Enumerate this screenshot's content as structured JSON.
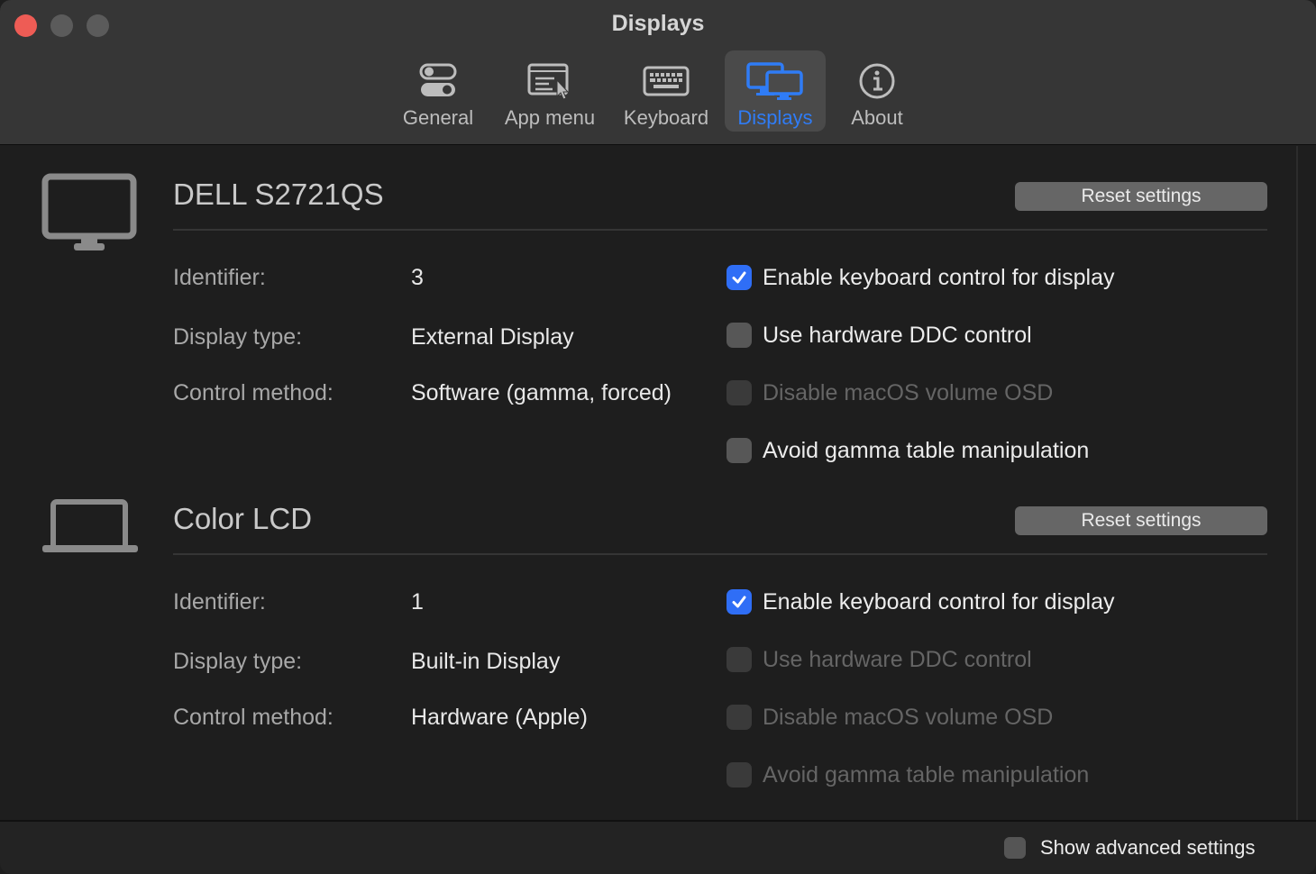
{
  "window": {
    "title": "Displays"
  },
  "tabs": [
    {
      "label": "General",
      "icon": "toggles-icon"
    },
    {
      "label": "App menu",
      "icon": "app-menu-icon"
    },
    {
      "label": "Keyboard",
      "icon": "keyboard-icon"
    },
    {
      "label": "Displays",
      "icon": "displays-icon",
      "active": true
    },
    {
      "label": "About",
      "icon": "info-icon"
    }
  ],
  "displays": [
    {
      "icon": "monitor-icon",
      "name": "DELL S2721QS",
      "reset_label": "Reset settings",
      "info": [
        {
          "label": "Identifier:",
          "value": "3"
        },
        {
          "label": "Display type:",
          "value": "External Display"
        },
        {
          "label": "Control method:",
          "value": "Software (gamma, forced)"
        }
      ],
      "options": [
        {
          "label": "Enable keyboard control for display",
          "checked": true,
          "enabled": true
        },
        {
          "label": "Use hardware DDC control",
          "checked": false,
          "enabled": true
        },
        {
          "label": "Disable macOS volume OSD",
          "checked": false,
          "enabled": false
        },
        {
          "label": "Avoid gamma table manipulation",
          "checked": false,
          "enabled": true
        }
      ]
    },
    {
      "icon": "laptop-icon",
      "name": "Color LCD",
      "reset_label": "Reset settings",
      "info": [
        {
          "label": "Identifier:",
          "value": "1"
        },
        {
          "label": "Display type:",
          "value": "Built-in Display"
        },
        {
          "label": "Control method:",
          "value": "Hardware (Apple)"
        }
      ],
      "options": [
        {
          "label": "Enable keyboard control for display",
          "checked": true,
          "enabled": true
        },
        {
          "label": "Use hardware DDC control",
          "checked": false,
          "enabled": false
        },
        {
          "label": "Disable macOS volume OSD",
          "checked": false,
          "enabled": false
        },
        {
          "label": "Avoid gamma table manipulation",
          "checked": false,
          "enabled": false
        }
      ]
    }
  ],
  "footer": {
    "show_advanced_label": "Show advanced settings",
    "show_advanced_checked": false
  },
  "colors": {
    "accent": "#2f7cf6",
    "close": "#ee5c55"
  }
}
